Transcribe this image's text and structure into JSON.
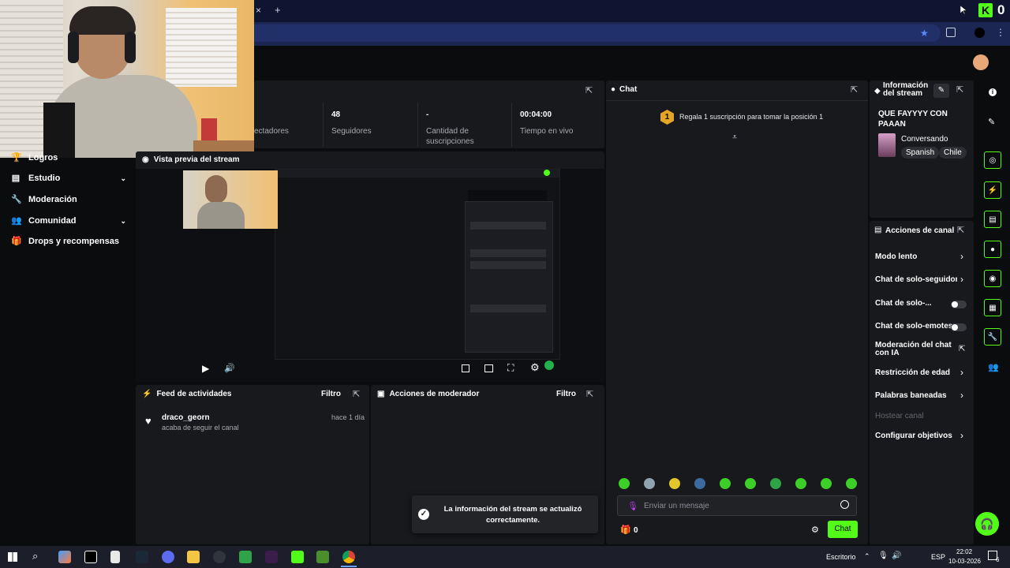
{
  "browser": {
    "new_tab_label": "+",
    "close_tab_label": "×",
    "kick_badge": "0"
  },
  "sidebar": {
    "items": [
      {
        "label": "Logros",
        "icon": "trophy-icon",
        "has_chevron": false
      },
      {
        "label": "Estudio",
        "icon": "studio-icon",
        "has_chevron": true
      },
      {
        "label": "Moderación",
        "icon": "wrench-icon",
        "has_chevron": false
      },
      {
        "label": "Comunidad",
        "icon": "people-icon",
        "has_chevron": true
      },
      {
        "label": "Drops y recompensas",
        "icon": "gift-icon",
        "has_chevron": false
      }
    ]
  },
  "stats": {
    "espectadores_label": "ectadores",
    "seguidores_value": "48",
    "seguidores_label": "Seguidores",
    "suscripciones_value": "-",
    "suscripciones_label_1": "Cantidad de",
    "suscripciones_label_2": "suscripciones",
    "tiempo_value": "00:04:00",
    "tiempo_label": "Tiempo en vivo"
  },
  "preview": {
    "title": "Vista previa del stream"
  },
  "feed": {
    "title": "Feed de actividades",
    "filter": "Filtro",
    "items": [
      {
        "user": "draco_georn",
        "action": "acaba de seguir el canal",
        "time": "hace 1 día"
      }
    ]
  },
  "mod_actions": {
    "title": "Acciones de moderador",
    "filter": "Filtro"
  },
  "toast": {
    "line1": "La información del stream se actualizó",
    "line2": "correctamente."
  },
  "chat": {
    "title": "Chat",
    "gift_rank": "1",
    "gift_text": "Regala 1 suscripción para tomar la posición 1",
    "input_placeholder": "Enviar un mensaje",
    "points": "0",
    "send_label": "Chat"
  },
  "stream_info": {
    "title_1": "Información",
    "title_2": "del stream",
    "stream_title_1": "QUE FAYYYY CON",
    "stream_title_2": "PAAAN",
    "category": "Conversando",
    "tags": [
      "Spanish",
      "Chile"
    ]
  },
  "channel_actions": {
    "title": "Acciones de canal",
    "items": [
      {
        "label": "Modo lento",
        "control": "arrow"
      },
      {
        "label": "Chat de solo-seguidores",
        "control": "arrow"
      },
      {
        "label": "Chat de solo-...",
        "control": "toggle"
      },
      {
        "label": "Chat de solo-emotes",
        "control": "toggle"
      },
      {
        "label": "Moderación del chat con IA",
        "control": "external"
      },
      {
        "label": "Restricción de edad",
        "control": "arrow"
      },
      {
        "label": "Palabras baneadas",
        "control": "arrow"
      },
      {
        "label": "Hostear canal",
        "control": "disabled"
      },
      {
        "label": "Configurar objetivos",
        "control": "arrow"
      }
    ]
  },
  "taskbar": {
    "language_label": "Escritorio",
    "ime": "ESP",
    "time": "22:02",
    "date": "10-03-2026",
    "notif_count": "6"
  },
  "colors": {
    "accent": "#53fc18",
    "panel": "#18191c",
    "background": "#0b0c0e"
  }
}
